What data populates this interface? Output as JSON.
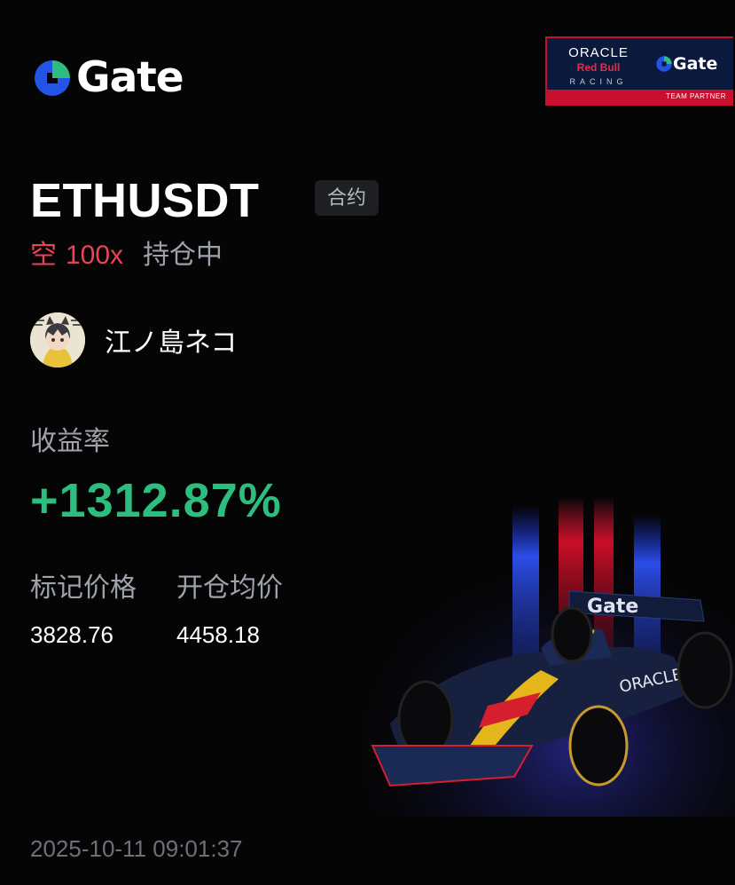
{
  "brand": {
    "logo_text": "Gate",
    "accent": "#2354e6",
    "accent_green": "#2dbe7f"
  },
  "partner_badge": {
    "line1": "ORACLE",
    "line2": "Red Bull",
    "line3": "RACING",
    "gate_text": "Gate",
    "footer": "TEAM PARTNER"
  },
  "trade": {
    "pair": "ETHUSDT",
    "contract_tag": "合约",
    "side": "空",
    "leverage": "100x",
    "status": "持仓中"
  },
  "user": {
    "name": "江ノ島ネコ"
  },
  "roi": {
    "label": "收益率",
    "value": "+1312.87%"
  },
  "prices": {
    "mark_label": "标记价格",
    "entry_label": "开仓均价",
    "mark_value": "3828.76",
    "entry_value": "4458.18"
  },
  "timestamp": "2025-10-11 09:01:37",
  "colors": {
    "background": "#050506",
    "short_red": "#e94359",
    "profit_green": "#2dbe7f",
    "muted_text": "#9ea2ab"
  }
}
